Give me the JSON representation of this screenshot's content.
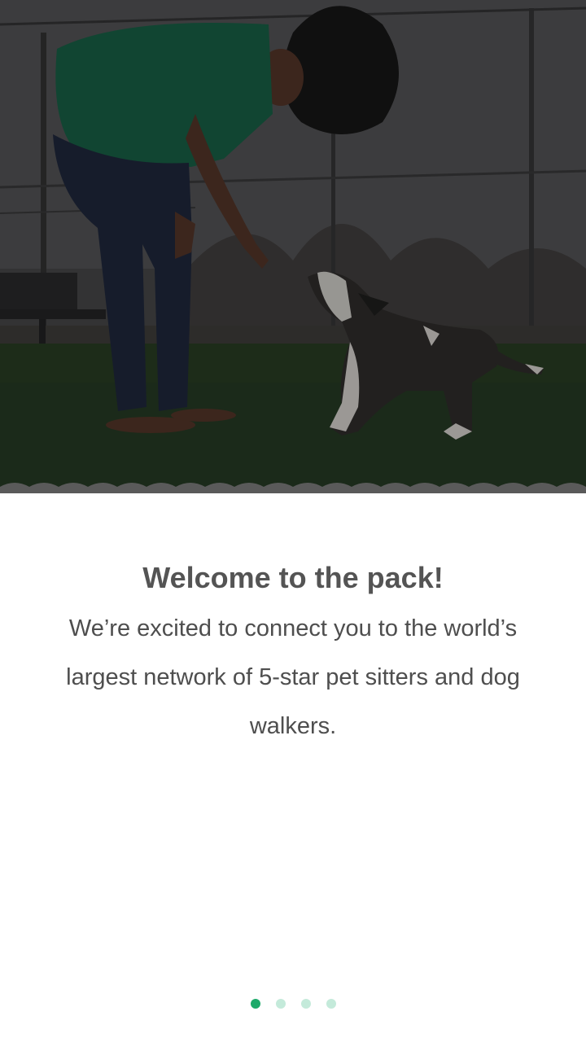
{
  "onboarding": {
    "hero_image": "woman-playing-with-dog-photo",
    "title": "Welcome to the pack!",
    "body": "We’re excited to connect you to the world’s largest network of 5-star pet sitters and dog walkers."
  },
  "pager": {
    "total_pages": 4,
    "active_page": 1,
    "active_color": "#1daa6a",
    "inactive_color": "#c4eada"
  }
}
